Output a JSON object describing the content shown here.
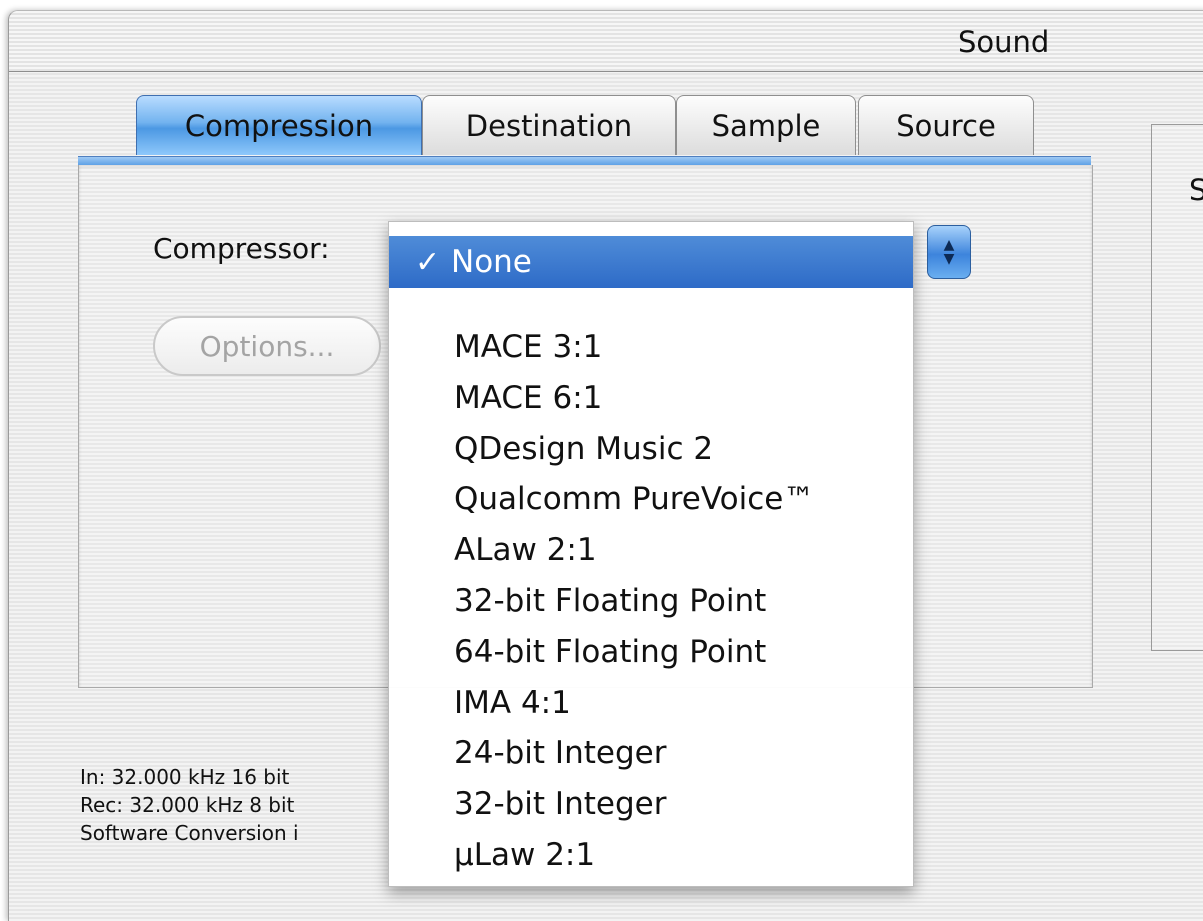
{
  "window": {
    "title": "Sound"
  },
  "tabs": [
    {
      "label": "Compression",
      "active": true
    },
    {
      "label": "Destination",
      "active": false
    },
    {
      "label": "Sample",
      "active": false
    },
    {
      "label": "Source",
      "active": false
    }
  ],
  "compressor": {
    "label": "Compressor:",
    "selected": "None",
    "check_glyph": "✓",
    "options_button": "Options..."
  },
  "menu": {
    "items": [
      "MACE 3:1",
      "MACE 6:1",
      "QDesign Music 2",
      "Qualcomm PureVoice™",
      "ALaw 2:1",
      "32-bit Floating Point",
      "64-bit Floating Point",
      "IMA 4:1",
      "24-bit Integer",
      "32-bit Integer",
      "µLaw 2:1"
    ]
  },
  "status": {
    "in": "In: 32.000 kHz 16 bit",
    "rec": "Rec: 32.000 kHz 8 bit",
    "conversion": "Software Conversion i"
  },
  "right_panel": {
    "partial_letter": "S"
  },
  "icons": {
    "popup_arrows": "popup-arrows-icon",
    "checkmark": "checkmark-icon"
  },
  "colors": {
    "accent": "#3a78d2",
    "tab_active": "#5ea6ee"
  }
}
